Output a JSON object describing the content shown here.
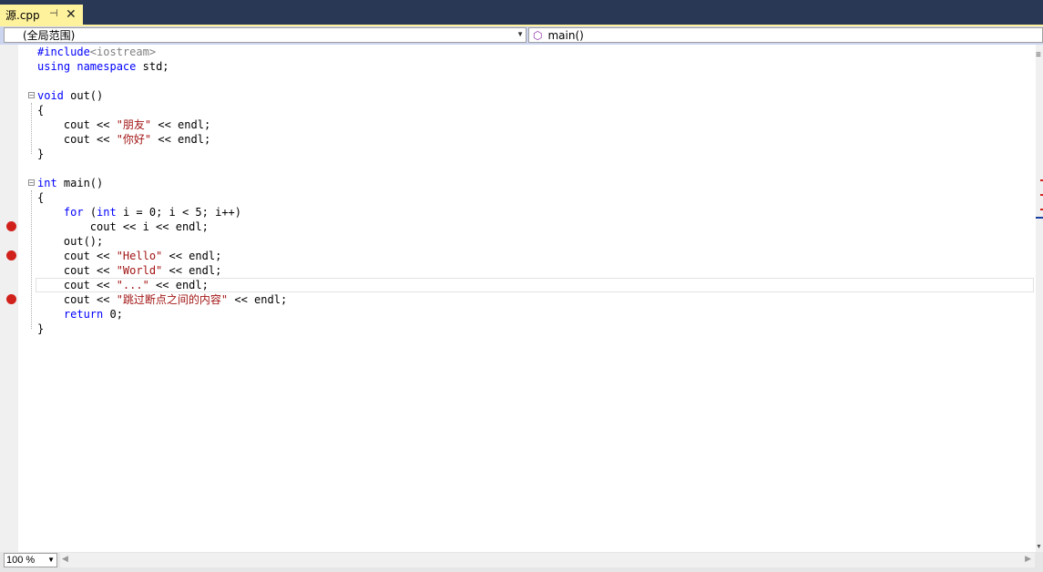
{
  "tab": {
    "title": "源.cpp",
    "pin_icon": "pin-icon",
    "close_icon": "close-icon"
  },
  "navbar": {
    "scope": "(全局范围)",
    "member": "main()",
    "member_icon": "method-icon"
  },
  "editor": {
    "lines": [
      {
        "text": "#include<iostream>",
        "breakpoint": false
      },
      {
        "text": "using namespace std;",
        "breakpoint": false
      },
      {
        "text": "",
        "breakpoint": false
      },
      {
        "text": "void out()",
        "breakpoint": false
      },
      {
        "text": "{",
        "breakpoint": false
      },
      {
        "text": "    cout << \"朋友\" << endl;",
        "breakpoint": false
      },
      {
        "text": "    cout << \"你好\" << endl;",
        "breakpoint": false
      },
      {
        "text": "}",
        "breakpoint": false
      },
      {
        "text": "",
        "breakpoint": false
      },
      {
        "text": "int main()",
        "breakpoint": false
      },
      {
        "text": "{",
        "breakpoint": false
      },
      {
        "text": "    for (int i = 0; i < 5; i++)",
        "breakpoint": false
      },
      {
        "text": "        cout << i << endl;",
        "breakpoint": true
      },
      {
        "text": "    out();",
        "breakpoint": false
      },
      {
        "text": "    cout << \"Hello\" << endl;",
        "breakpoint": true
      },
      {
        "text": "    cout << \"World\" << endl;",
        "breakpoint": false
      },
      {
        "text": "    cout << \"...\" << endl;",
        "breakpoint": false
      },
      {
        "text": "    cout << \"跳过断点之间的内容\" << endl;",
        "breakpoint": true
      },
      {
        "text": "    return 0;",
        "breakpoint": false
      },
      {
        "text": "}",
        "breakpoint": false
      }
    ],
    "current_line": 17,
    "colors": {
      "keyword": "#0000ff",
      "string": "#a31515",
      "preprocessor": "#808080",
      "breakpoint": "#d1211b"
    }
  },
  "statusbar": {
    "zoom": "100 %"
  }
}
